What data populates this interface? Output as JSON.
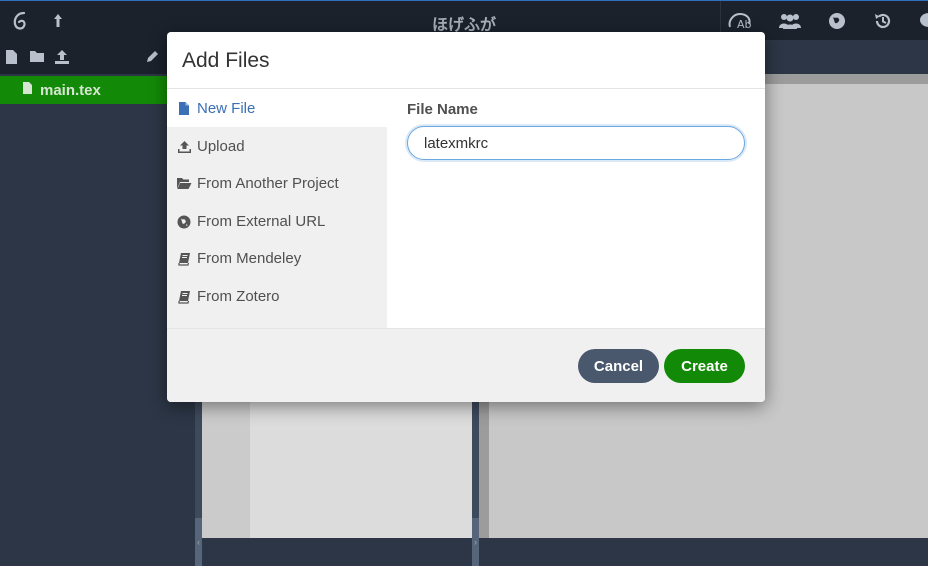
{
  "app": {
    "project_title": "ほげふが"
  },
  "file_tree": {
    "selected_file": "main.tex"
  },
  "modal": {
    "title": "Add Files",
    "sidebar": {
      "items": [
        {
          "label": "New File",
          "icon": "file-icon",
          "active": true
        },
        {
          "label": "Upload",
          "icon": "upload-icon",
          "active": false
        },
        {
          "label": "From Another Project",
          "icon": "folder-open-icon",
          "active": false
        },
        {
          "label": "From External URL",
          "icon": "globe-icon",
          "active": false
        },
        {
          "label": "From Mendeley",
          "icon": "book-icon",
          "active": false
        },
        {
          "label": "From Zotero",
          "icon": "book-icon",
          "active": false
        }
      ]
    },
    "form": {
      "file_name_label": "File Name",
      "file_name_value": "latexmkrc"
    },
    "footer": {
      "cancel_label": "Cancel",
      "create_label": "Create"
    }
  },
  "colors": {
    "accent_green": "#138a07",
    "active_blue": "#3b6fb6",
    "topbar": "#1b222c"
  }
}
